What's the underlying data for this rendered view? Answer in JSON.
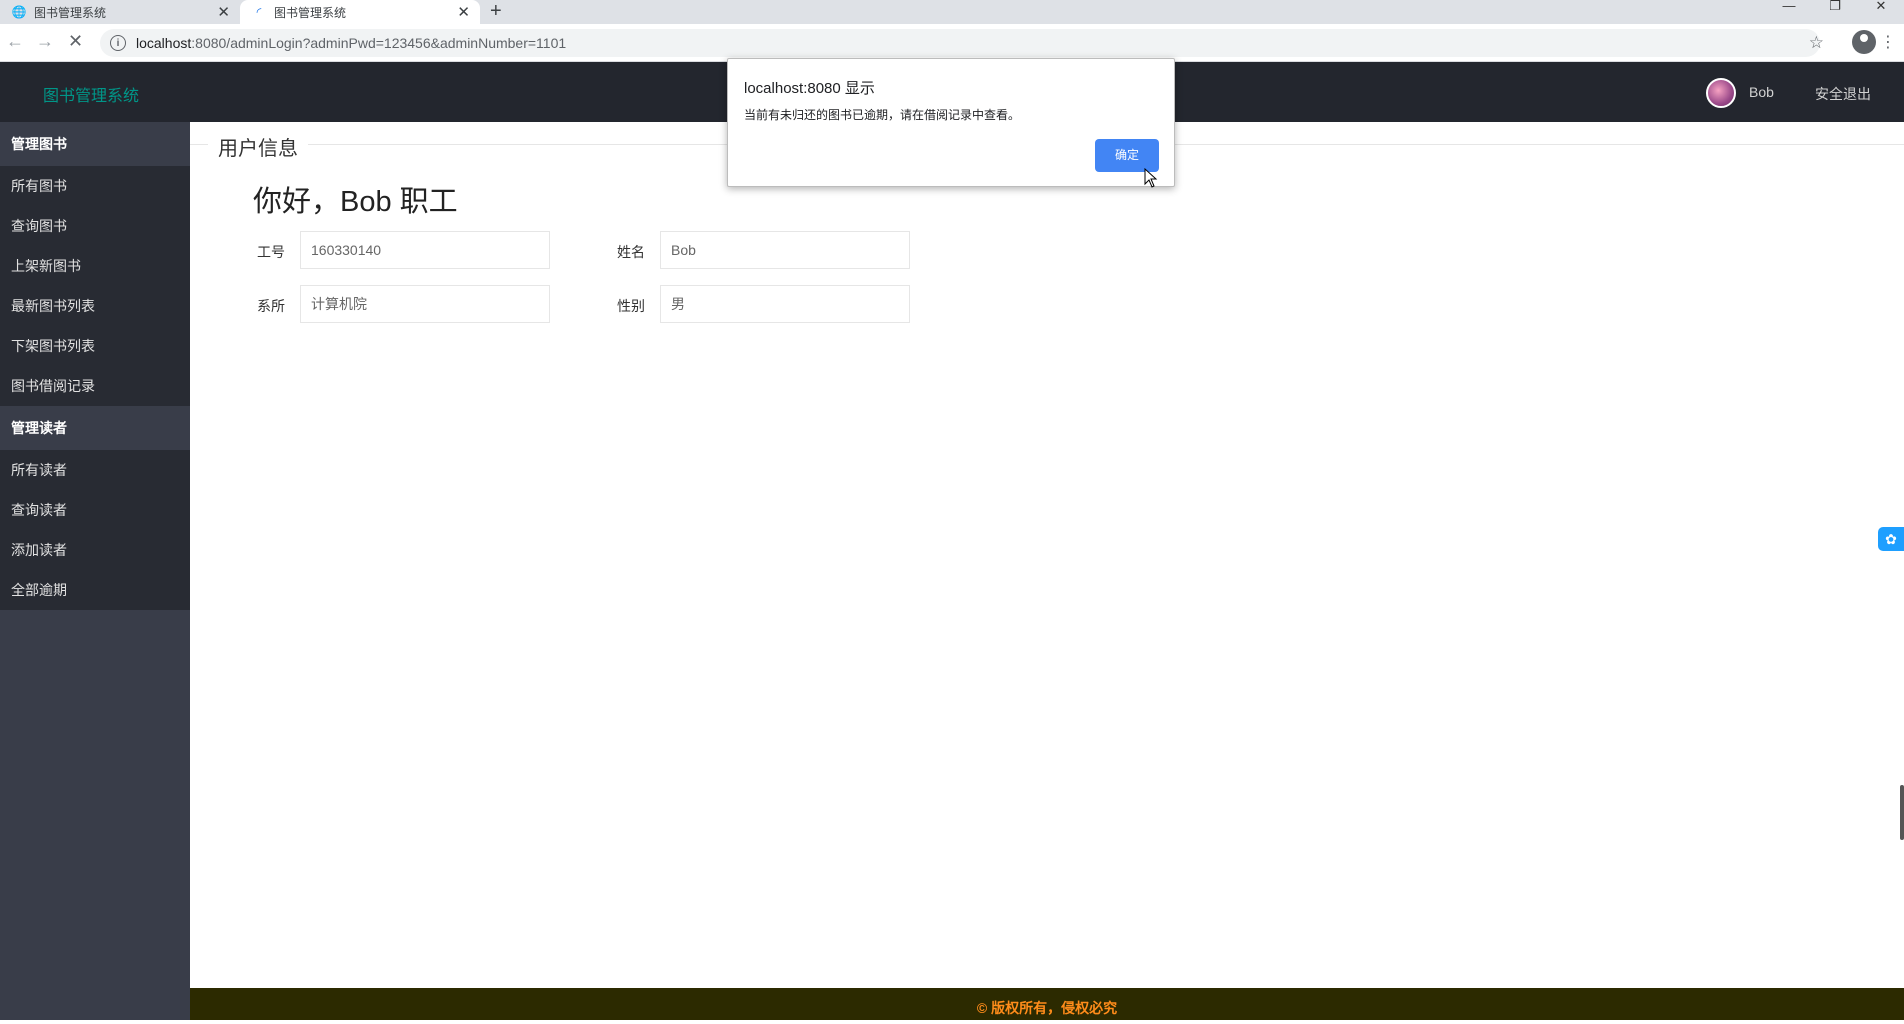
{
  "browser": {
    "tabs": [
      {
        "title": "图书管理系统"
      },
      {
        "title": "图书管理系统"
      }
    ],
    "new_tab": "+",
    "window_controls": [
      "—",
      "❐",
      "✕"
    ],
    "url_host": "localhost",
    "url_rest": ":8080/adminLogin?adminPwd=123456&adminNumber=1101"
  },
  "header": {
    "logo": "图书管理系统",
    "user_name": "Bob",
    "logout": "安全退出"
  },
  "sidebar": {
    "groups": [
      {
        "title": "管理图书",
        "items": [
          "所有图书",
          "查询图书",
          "上架新图书",
          "最新图书列表",
          "下架图书列表",
          "图书借阅记录"
        ]
      },
      {
        "title": "管理读者",
        "items": [
          "所有读者",
          "查询读者",
          "添加读者",
          "全部逾期"
        ]
      }
    ]
  },
  "main": {
    "section_title": "用户信息",
    "greeting": "你好，Bob 职工",
    "fields": {
      "number_label": "工号",
      "number_value": "160330140",
      "name_label": "姓名",
      "name_value": "Bob",
      "dept_label": "系所",
      "dept_value": "计算机院",
      "gender_label": "性别",
      "gender_value": "男"
    }
  },
  "footer": {
    "text": "© 版权所有，侵权必究"
  },
  "dialog": {
    "title": "localhost:8080 显示",
    "message": "当前有未归还的图书已逾期，请在借阅记录中查看。",
    "ok_label": "确定"
  }
}
